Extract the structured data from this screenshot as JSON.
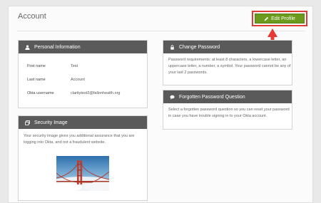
{
  "header": {
    "title": "Account",
    "edit_button_label": "Edit Profile"
  },
  "personal_info": {
    "title": "Personal Information",
    "fields": [
      {
        "label": "First name",
        "value": "Test"
      },
      {
        "label": "Last name",
        "value": "Account"
      },
      {
        "label": "Okta username",
        "value": "claritytest2@fallonhealth.org"
      }
    ]
  },
  "change_password": {
    "title": "Change Password",
    "description": "Password requirements: at least 8 characters, a lowercase letter, an uppercase letter, a number, a symbol. Your password cannot be any of your last 2 passwords."
  },
  "forgotten_password": {
    "title": "Forgotten Password Question",
    "description": "Select a forgotten password question so you can reset your password in case you have trouble signing in to your Okta account."
  },
  "security_image": {
    "title": "Security Image",
    "description": "Your security image gives you additional assurance that you are logging into Okta, and not a fraudulent website."
  },
  "icons": {
    "edit": "pencil-icon",
    "person": "person-icon",
    "lock": "lock-icon",
    "speech": "speech-bubble-icon",
    "image": "image-icon"
  },
  "colors": {
    "header_bg": "#5a5a5a",
    "edit_button_bg": "#6c9a1d",
    "highlight": "#e53935"
  }
}
